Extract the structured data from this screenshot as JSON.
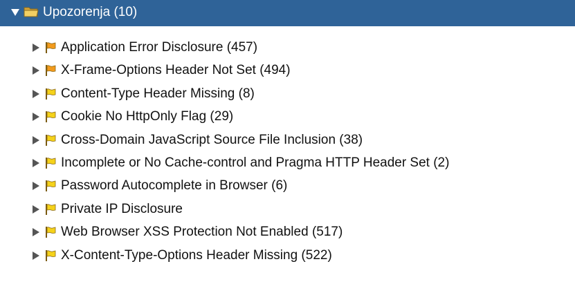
{
  "tree": {
    "root": {
      "label": "Upozorenja (10)",
      "icon": "folder-icon",
      "expanded": true,
      "row_color": "#2f6398"
    },
    "items": [
      {
        "label": "Application Error Disclosure (457)",
        "flag": "medium",
        "flag_color": "#f29a1c"
      },
      {
        "label": "X-Frame-Options Header Not Set (494)",
        "flag": "medium",
        "flag_color": "#f29a1c"
      },
      {
        "label": "Content-Type Header Missing (8)",
        "flag": "low",
        "flag_color": "#f5d21a"
      },
      {
        "label": "Cookie No HttpOnly Flag (29)",
        "flag": "low",
        "flag_color": "#f5d21a"
      },
      {
        "label": "Cross-Domain JavaScript Source File Inclusion (38)",
        "flag": "low",
        "flag_color": "#f5d21a"
      },
      {
        "label": "Incomplete or No Cache-control and Pragma HTTP Header Set (2)",
        "flag": "low",
        "flag_color": "#f5d21a"
      },
      {
        "label": "Password Autocomplete in Browser (6)",
        "flag": "low",
        "flag_color": "#f5d21a"
      },
      {
        "label": "Private IP Disclosure",
        "flag": "low",
        "flag_color": "#f5d21a"
      },
      {
        "label": "Web Browser XSS Protection Not Enabled (517)",
        "flag": "low",
        "flag_color": "#f5d21a"
      },
      {
        "label": "X-Content-Type-Options Header Missing (522)",
        "flag": "low",
        "flag_color": "#f5d21a"
      }
    ]
  }
}
